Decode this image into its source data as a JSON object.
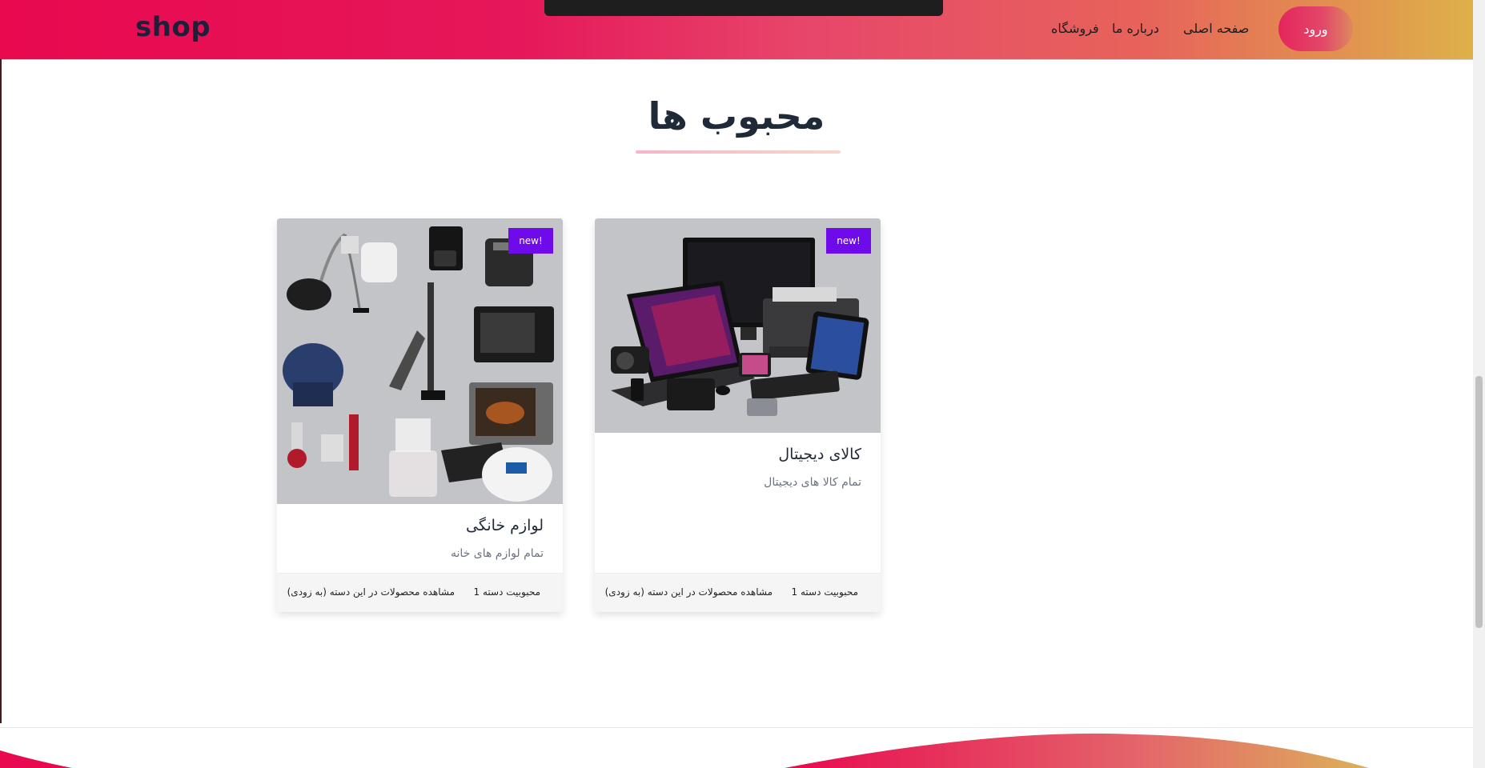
{
  "header": {
    "logo": "shop",
    "nav": {
      "home": "صفحه اصلی",
      "about": "درباره ما",
      "shop": "فروشگاه"
    },
    "login_label": "ورود"
  },
  "section": {
    "title": "محبوب ها"
  },
  "cards": [
    {
      "badge": "new!",
      "title": "کالای دیجیتال",
      "subtitle": "تمام کالا های دیجیتال",
      "popularity": "محبوبیت دسته 1",
      "view_products": "مشاهده محصولات در این دسته (به زودی)"
    },
    {
      "badge": "new!",
      "title": "لوازم خانگی",
      "subtitle": "تمام لوازم های خانه",
      "popularity": "محبوبیت دسته 1",
      "view_products": "مشاهده محصولات در این دسته (به زودی)"
    }
  ],
  "colors": {
    "brand_pink": "#e8094f",
    "brand_gold": "#deb149",
    "badge": "#6f0bea"
  }
}
